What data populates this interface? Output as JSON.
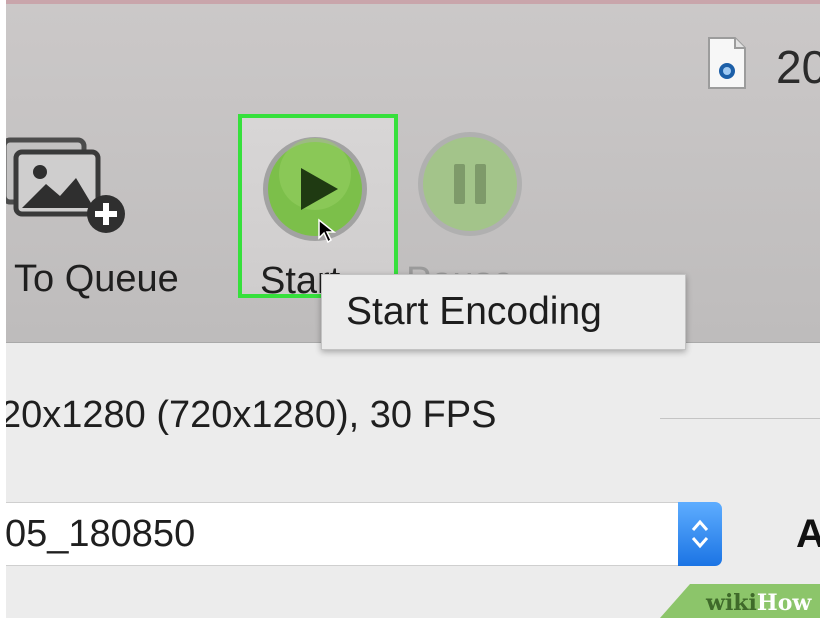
{
  "toolbar": {
    "document_title": "20",
    "add_to_queue_label": "To Queue",
    "start_label": "Start",
    "pause_label": "Pause"
  },
  "tooltip": {
    "text": "Start Encoding"
  },
  "source_info": {
    "resolution_text": "20x1280 (720x1280), 30 FPS"
  },
  "title_select": {
    "value": "05_180850"
  },
  "side_label": "A",
  "watermark": {
    "part1": "wiki",
    "part2": "How"
  },
  "colors": {
    "highlight": "#36e03c",
    "start_green": "#7cbf4a",
    "select_accent": "#1b74e4",
    "toolbar_bg": "#c6c4c4"
  },
  "icons": {
    "document": "mov-document-icon",
    "queue": "add-to-queue-icon",
    "start": "play-icon",
    "pause": "pause-icon",
    "cursor": "mouse-cursor-icon",
    "select": "select-arrows-icon"
  }
}
